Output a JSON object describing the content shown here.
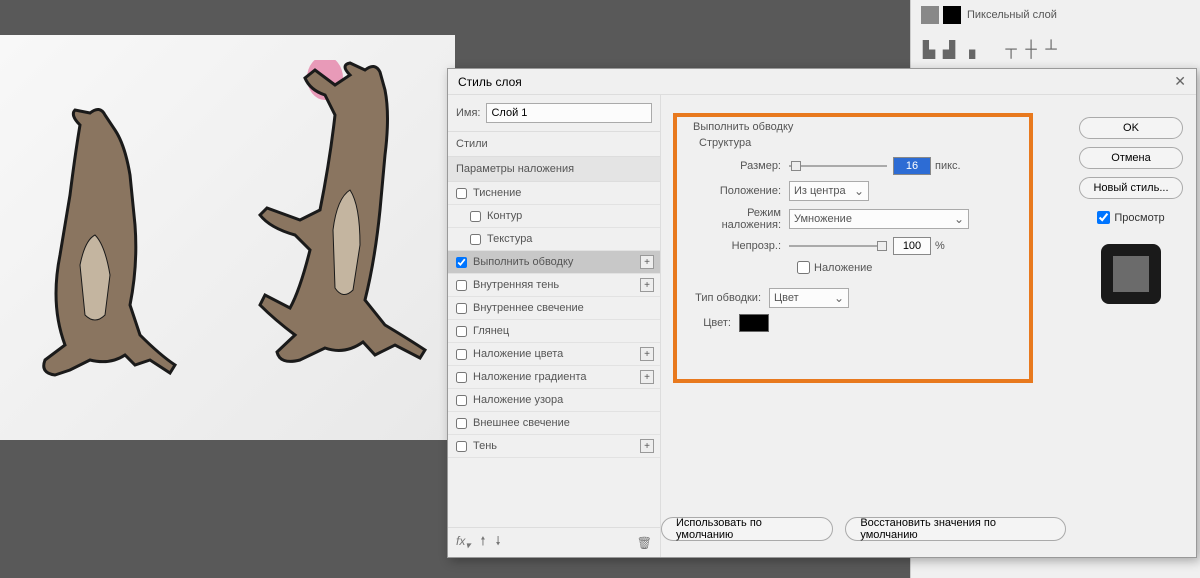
{
  "layers_panel": {
    "layer_label": "Пиксельный слой"
  },
  "dialog": {
    "title": "Стиль слоя",
    "name_label": "Имя:",
    "name_value": "Слой 1",
    "styles_header": "Стили",
    "params_header": "Параметры наложения",
    "style_items": [
      {
        "label": "Тиснение",
        "checked": false
      },
      {
        "label": "Контур",
        "checked": false,
        "indent": true
      },
      {
        "label": "Текстура",
        "checked": false,
        "indent": true
      },
      {
        "label": "Выполнить обводку",
        "checked": true,
        "plus": true,
        "active": true
      },
      {
        "label": "Внутренняя тень",
        "checked": false,
        "plus": true
      },
      {
        "label": "Внутреннее свечение",
        "checked": false
      },
      {
        "label": "Глянец",
        "checked": false
      },
      {
        "label": "Наложение цвета",
        "checked": false,
        "plus": true
      },
      {
        "label": "Наложение градиента",
        "checked": false,
        "plus": true
      },
      {
        "label": "Наложение узора",
        "checked": false
      },
      {
        "label": "Внешнее свечение",
        "checked": false
      },
      {
        "label": "Тень",
        "checked": false,
        "plus": true
      }
    ],
    "settings": {
      "section_title": "Выполнить обводку",
      "structure_title": "Структура",
      "size_label": "Размер:",
      "size_value": "16",
      "size_unit": "пикс.",
      "position_label": "Положение:",
      "position_value": "Из центра",
      "blend_label": "Режим наложения:",
      "blend_value": "Умножение",
      "opacity_label": "Непрозр.:",
      "opacity_value": "100",
      "opacity_unit": "%",
      "overlay_label": "Наложение",
      "stroke_type_label": "Тип обводки:",
      "stroke_type_value": "Цвет",
      "color_label": "Цвет:"
    },
    "buttons": {
      "default": "Использовать по умолчанию",
      "restore": "Восстановить значения по умолчанию",
      "ok": "OK",
      "cancel": "Отмена",
      "new_style": "Новый стиль...",
      "preview": "Просмотр"
    }
  }
}
